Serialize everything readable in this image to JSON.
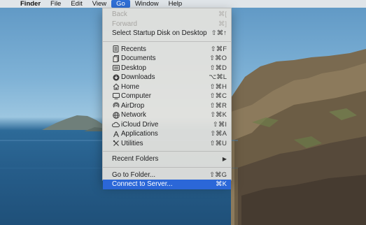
{
  "menubar": {
    "apple_icon": "apple-logo-icon",
    "items": [
      "Finder",
      "File",
      "Edit",
      "View",
      "Go",
      "Window",
      "Help"
    ],
    "active": "Go"
  },
  "go_menu": {
    "group1": [
      {
        "label": "Back",
        "shortcut": "⌘[",
        "enabled": false
      },
      {
        "label": "Forward",
        "shortcut": "⌘]",
        "enabled": false
      },
      {
        "label": "Select Startup Disk on Desktop",
        "shortcut": "⇧⌘↑",
        "enabled": true
      }
    ],
    "group2": [
      {
        "label": "Recents",
        "shortcut": "⇧⌘F",
        "icon": "recents-icon"
      },
      {
        "label": "Documents",
        "shortcut": "⇧⌘O",
        "icon": "documents-icon"
      },
      {
        "label": "Desktop",
        "shortcut": "⇧⌘D",
        "icon": "desktop-icon"
      },
      {
        "label": "Downloads",
        "shortcut": "⌥⌘L",
        "icon": "downloads-icon"
      },
      {
        "label": "Home",
        "shortcut": "⇧⌘H",
        "icon": "home-icon"
      },
      {
        "label": "Computer",
        "shortcut": "⇧⌘C",
        "icon": "computer-icon"
      },
      {
        "label": "AirDrop",
        "shortcut": "⇧⌘R",
        "icon": "airdrop-icon"
      },
      {
        "label": "Network",
        "shortcut": "⇧⌘K",
        "icon": "network-icon"
      },
      {
        "label": "iCloud Drive",
        "shortcut": "⇧⌘I",
        "icon": "icloud-icon"
      },
      {
        "label": "Applications",
        "shortcut": "⇧⌘A",
        "icon": "applications-icon"
      },
      {
        "label": "Utilities",
        "shortcut": "⇧⌘U",
        "icon": "utilities-icon"
      }
    ],
    "group3": [
      {
        "label": "Recent Folders",
        "submenu_arrow": "▶"
      }
    ],
    "group4": [
      {
        "label": "Go to Folder...",
        "shortcut": "⇧⌘G"
      },
      {
        "label": "Connect to Server...",
        "shortcut": "⌘K",
        "highlighted": true
      }
    ]
  },
  "colors": {
    "highlight": "#2b67d8",
    "active_menu": "#2f6fd6"
  }
}
